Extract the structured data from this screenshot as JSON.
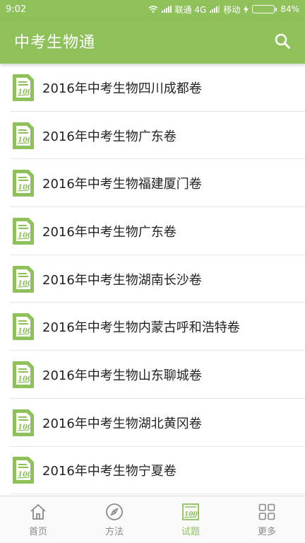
{
  "status_bar": {
    "time": "9:02",
    "carrier1": "联通 4G",
    "carrier2": "移动",
    "battery": "84%",
    "battery_level": 0.84
  },
  "app_bar": {
    "title": "中考生物通",
    "search_icon": "search-icon"
  },
  "colors": {
    "primary": "#8fc15a",
    "text": "#222222",
    "tab_inactive": "#8a8a8a"
  },
  "list": {
    "item_icon": "exam-paper-icon",
    "icon_text": "100",
    "items": [
      {
        "label": "2016年中考生物四川成都卷"
      },
      {
        "label": "2016年中考生物广东卷"
      },
      {
        "label": "2016年中考生物福建厦门卷"
      },
      {
        "label": "2016年中考生物广东卷"
      },
      {
        "label": "2016年中考生物湖南长沙卷"
      },
      {
        "label": "2016年中考生物内蒙古呼和浩特卷"
      },
      {
        "label": "2016年中考生物山东聊城卷"
      },
      {
        "label": "2016年中考生物湖北黄冈卷"
      },
      {
        "label": "2016年中考生物宁夏卷"
      }
    ]
  },
  "tabs": [
    {
      "label": "首页",
      "icon": "home-icon",
      "active": false
    },
    {
      "label": "方法",
      "icon": "compass-icon",
      "active": false
    },
    {
      "label": "试题",
      "icon": "exam-paper-icon",
      "active": true
    },
    {
      "label": "更多",
      "icon": "grid-icon",
      "active": false
    }
  ]
}
